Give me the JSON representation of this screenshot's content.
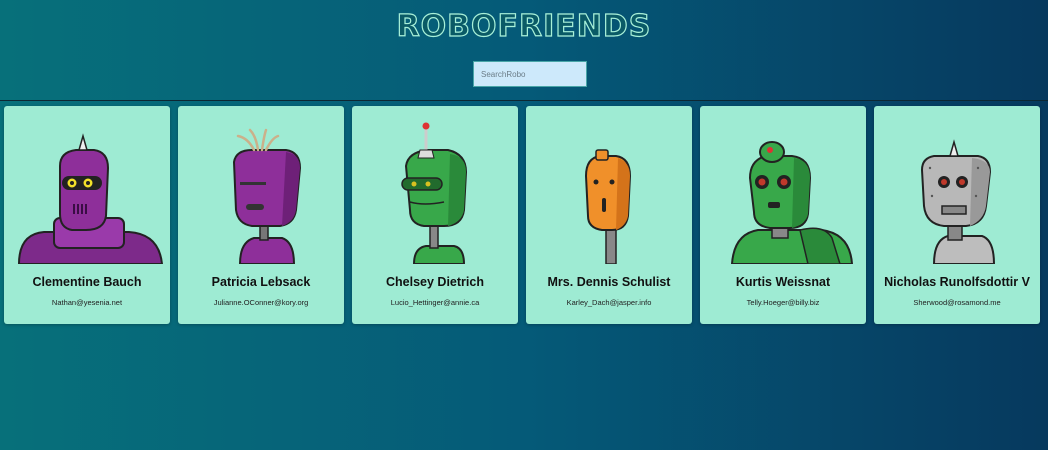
{
  "header": {
    "title": "RoboFriends"
  },
  "search": {
    "placeholder": "SearchRobo",
    "value": ""
  },
  "robots": [
    {
      "name": "Clementine Bauch",
      "email": "Nathan@yesenia.net",
      "image": "purple-robot-spike-yellow-eyes",
      "color": "#8e2f9a"
    },
    {
      "name": "Patricia Lebsack",
      "email": "Julianne.OConner@kory.org",
      "image": "purple-robot-wires",
      "color": "#8e2f9a"
    },
    {
      "name": "Chelsey Dietrich",
      "email": "Lucio_Hettinger@annie.ca",
      "image": "green-robot-antenna",
      "color": "#38a84a"
    },
    {
      "name": "Mrs. Dennis Schulist",
      "email": "Karley_Dach@jasper.info",
      "image": "orange-robot",
      "color": "#f0902a"
    },
    {
      "name": "Kurtis Weissnat",
      "email": "Telly.Hoeger@billy.biz",
      "image": "green-robot-dome",
      "color": "#38a84a"
    },
    {
      "name": "Nicholas Runolfsdottir V",
      "email": "Sherwood@rosamond.me",
      "image": "gray-robot-spike",
      "color": "#a9a9a9"
    }
  ]
}
